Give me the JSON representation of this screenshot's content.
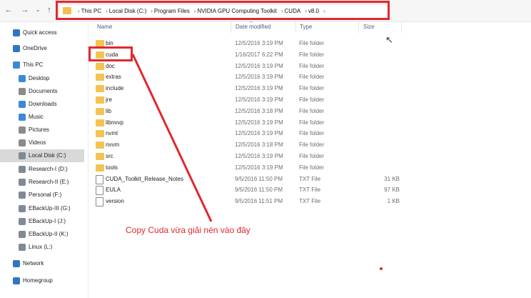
{
  "address_bar": {
    "crumbs": [
      "This PC",
      "Local Disk (C:)",
      "Program Files",
      "NVIDIA GPU Computing Toolkit",
      "CUDA",
      "v8.0"
    ]
  },
  "sidebar": {
    "items": [
      {
        "label": "Quick access",
        "icon": "star-icon",
        "color": "#2f76c5"
      },
      {
        "label": "OneDrive",
        "icon": "cloud-icon",
        "color": "#2f76c5"
      },
      {
        "label": "This PC",
        "icon": "computer-icon",
        "color": "#3a8ad8"
      },
      {
        "label": "Desktop",
        "icon": "desktop-icon",
        "color": "#3a8ad8"
      },
      {
        "label": "Documents",
        "icon": "documents-icon",
        "color": "#8a8a8a"
      },
      {
        "label": "Downloads",
        "icon": "download-icon",
        "color": "#3a8ad8"
      },
      {
        "label": "Music",
        "icon": "music-icon",
        "color": "#3a8ad8"
      },
      {
        "label": "Pictures",
        "icon": "pictures-icon",
        "color": "#8a8a8a"
      },
      {
        "label": "Videos",
        "icon": "videos-icon",
        "color": "#8a8a8a"
      },
      {
        "label": "Local Disk (C:)",
        "icon": "drive-icon",
        "color": "#7f8a95"
      },
      {
        "label": "Research-I (D:)",
        "icon": "drive-icon",
        "color": "#7f8a95"
      },
      {
        "label": "Research-II (E:)",
        "icon": "drive-icon",
        "color": "#7f8a95"
      },
      {
        "label": "Personal (F:)",
        "icon": "drive-icon",
        "color": "#7f8a95"
      },
      {
        "label": "EBackUp-III (G:)",
        "icon": "drive-icon",
        "color": "#7f8a95"
      },
      {
        "label": "EBackUp-I (J:)",
        "icon": "drive-icon",
        "color": "#7f8a95"
      },
      {
        "label": "EBackUp-II (K:)",
        "icon": "drive-icon",
        "color": "#7f8a95"
      },
      {
        "label": "Linux (L:)",
        "icon": "drive-icon",
        "color": "#7f8a95"
      },
      {
        "label": "Network",
        "icon": "network-icon",
        "color": "#2f76c5"
      },
      {
        "label": "Homegroup",
        "icon": "homegroup-icon",
        "color": "#2f76c5"
      }
    ]
  },
  "columns": {
    "name": "Name",
    "date": "Date modified",
    "type": "Type",
    "size": "Size"
  },
  "files": [
    {
      "name": "bin",
      "date": "12/5/2016 3:19 PM",
      "type": "File folder",
      "size": "",
      "kind": "folder"
    },
    {
      "name": "cuda",
      "date": "1/16/2017 6:22 PM",
      "type": "File folder",
      "size": "",
      "kind": "folder"
    },
    {
      "name": "doc",
      "date": "12/5/2016 3:19 PM",
      "type": "File folder",
      "size": "",
      "kind": "folder"
    },
    {
      "name": "extras",
      "date": "12/5/2016 3:19 PM",
      "type": "File folder",
      "size": "",
      "kind": "folder"
    },
    {
      "name": "include",
      "date": "12/5/2016 3:19 PM",
      "type": "File folder",
      "size": "",
      "kind": "folder"
    },
    {
      "name": "jre",
      "date": "12/5/2016 3:19 PM",
      "type": "File folder",
      "size": "",
      "kind": "folder"
    },
    {
      "name": "lib",
      "date": "12/5/2016 3:18 PM",
      "type": "File folder",
      "size": "",
      "kind": "folder"
    },
    {
      "name": "libnvvp",
      "date": "12/5/2016 3:19 PM",
      "type": "File folder",
      "size": "",
      "kind": "folder"
    },
    {
      "name": "nvml",
      "date": "12/5/2016 3:19 PM",
      "type": "File folder",
      "size": "",
      "kind": "folder"
    },
    {
      "name": "nvvm",
      "date": "12/5/2016 3:18 PM",
      "type": "File folder",
      "size": "",
      "kind": "folder"
    },
    {
      "name": "src",
      "date": "12/5/2016 3:19 PM",
      "type": "File folder",
      "size": "",
      "kind": "folder"
    },
    {
      "name": "tools",
      "date": "12/5/2016 3:19 PM",
      "type": "File folder",
      "size": "",
      "kind": "folder"
    },
    {
      "name": "CUDA_Toolkit_Release_Notes",
      "date": "9/5/2016 11:50 PM",
      "type": "TXT File",
      "size": "31 KB",
      "kind": "txt"
    },
    {
      "name": "EULA",
      "date": "9/5/2016 11:50 PM",
      "type": "TXT File",
      "size": "97 KB",
      "kind": "txt"
    },
    {
      "name": "version",
      "date": "9/5/2016 11:51 PM",
      "type": "TXT File",
      "size": "1 KB",
      "kind": "txt"
    }
  ],
  "annotation": {
    "text": "Copy Cuda vừa giải nén vào đây",
    "color": "#e0282e"
  },
  "colors": {
    "folder": "#f3c452",
    "selected_bg": "#d9d9d9",
    "header_text": "#4d6185"
  }
}
